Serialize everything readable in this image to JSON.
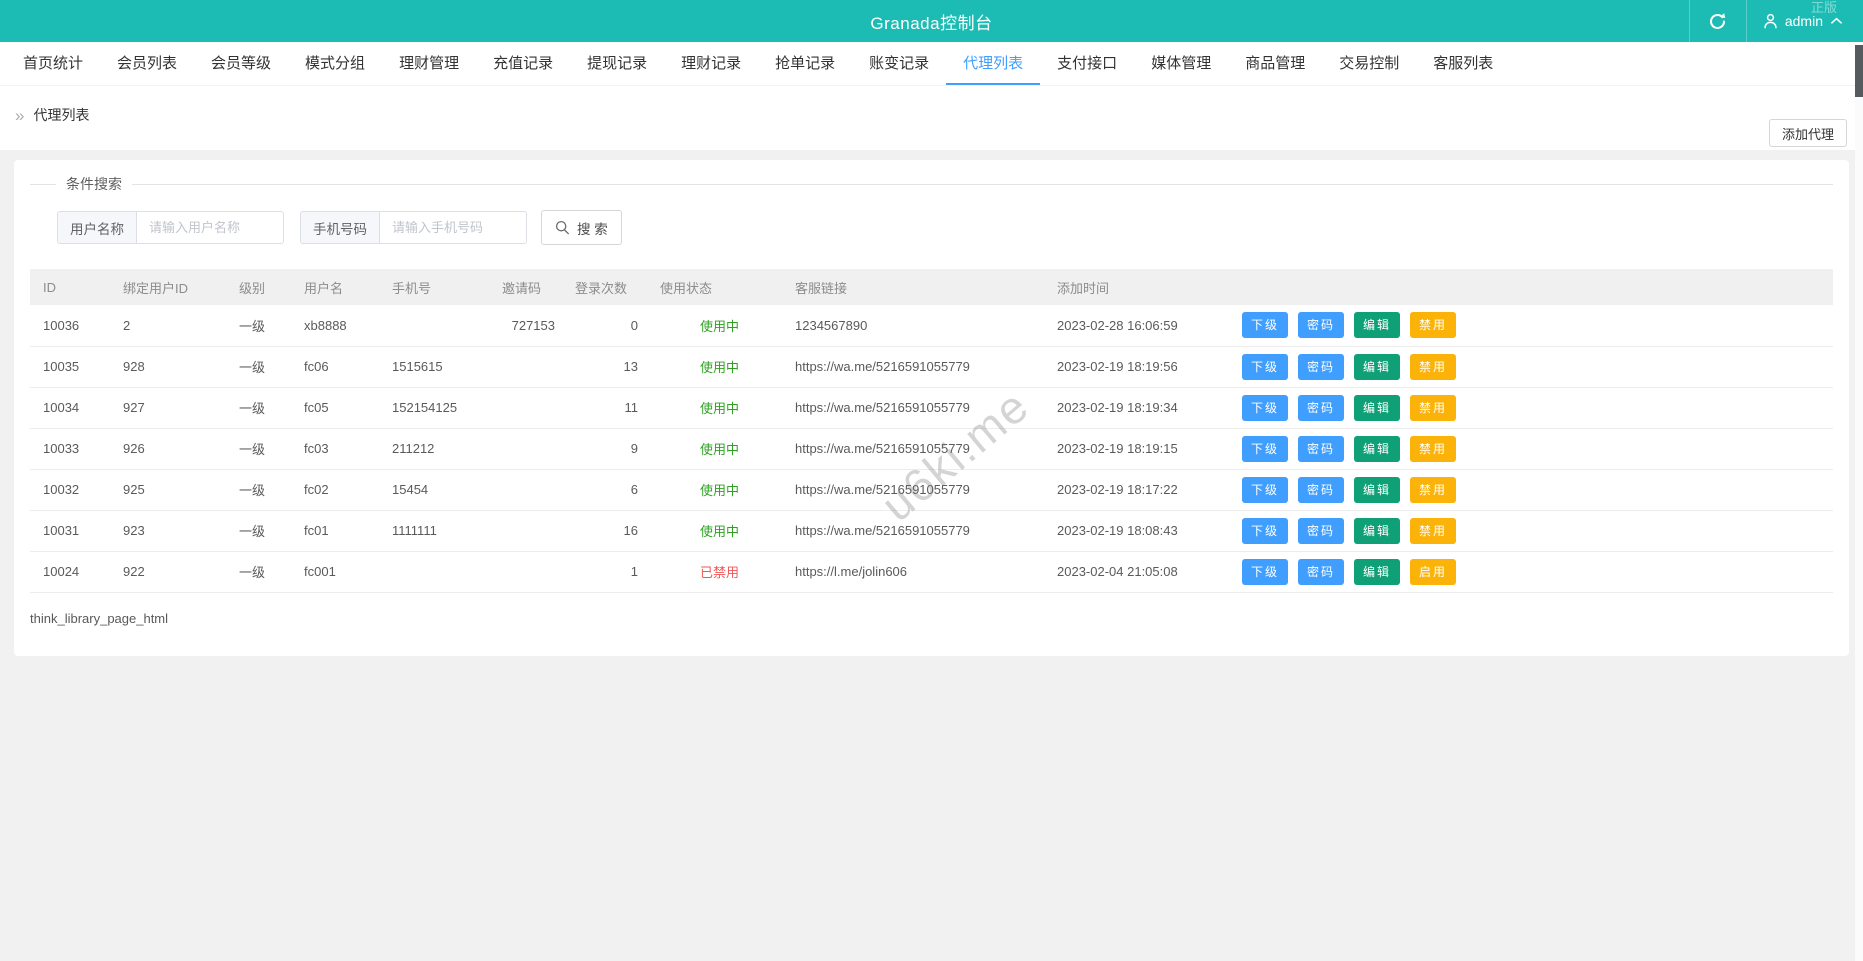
{
  "header": {
    "title": "Granada控制台",
    "user": "admin",
    "corner_watermark": "正版"
  },
  "nav": {
    "tabs": [
      {
        "label": "首页统计",
        "active": false
      },
      {
        "label": "会员列表",
        "active": false
      },
      {
        "label": "会员等级",
        "active": false
      },
      {
        "label": "模式分组",
        "active": false
      },
      {
        "label": "理财管理",
        "active": false
      },
      {
        "label": "充值记录",
        "active": false
      },
      {
        "label": "提现记录",
        "active": false
      },
      {
        "label": "理财记录",
        "active": false
      },
      {
        "label": "抢单记录",
        "active": false
      },
      {
        "label": "账变记录",
        "active": false
      },
      {
        "label": "代理列表",
        "active": true
      },
      {
        "label": "支付接口",
        "active": false
      },
      {
        "label": "媒体管理",
        "active": false
      },
      {
        "label": "商品管理",
        "active": false
      },
      {
        "label": "交易控制",
        "active": false
      },
      {
        "label": "客服列表",
        "active": false
      }
    ]
  },
  "breadcrumb": {
    "label": "代理列表"
  },
  "toolbar": {
    "add_agent_label": "添加代理"
  },
  "search": {
    "legend": "条件搜索",
    "username_label": "用户名称",
    "username_placeholder": "请输入用户名称",
    "username_value": "",
    "phone_label": "手机号码",
    "phone_placeholder": "请输入手机号码",
    "phone_value": "",
    "search_button": "搜 索"
  },
  "table": {
    "headers": [
      "ID",
      "绑定用户ID",
      "级别",
      "用户名",
      "手机号",
      "邀请码",
      "登录次数",
      "使用状态",
      "客服链接",
      "添加时间",
      ""
    ],
    "rows": [
      {
        "id": "10036",
        "bind_user_id": "2",
        "level": "一级",
        "username": "xb8888",
        "phone": "",
        "invite_code": "727153",
        "login_count": "0",
        "status": "使用中",
        "status_type": "active",
        "service_link": "1234567890",
        "added_time": "2023-02-28 16:06:59",
        "actions": [
          "下级",
          "密码",
          "编辑",
          "禁用"
        ]
      },
      {
        "id": "10035",
        "bind_user_id": "928",
        "level": "一级",
        "username": "fc06",
        "phone": "1515615",
        "invite_code": "",
        "login_count": "13",
        "status": "使用中",
        "status_type": "active",
        "service_link": "https://wa.me/5216591055779",
        "added_time": "2023-02-19 18:19:56",
        "actions": [
          "下级",
          "密码",
          "编辑",
          "禁用"
        ]
      },
      {
        "id": "10034",
        "bind_user_id": "927",
        "level": "一级",
        "username": "fc05",
        "phone": "152154125",
        "invite_code": "",
        "login_count": "11",
        "status": "使用中",
        "status_type": "active",
        "service_link": "https://wa.me/5216591055779",
        "added_time": "2023-02-19 18:19:34",
        "actions": [
          "下级",
          "密码",
          "编辑",
          "禁用"
        ]
      },
      {
        "id": "10033",
        "bind_user_id": "926",
        "level": "一级",
        "username": "fc03",
        "phone": "211212",
        "invite_code": "",
        "login_count": "9",
        "status": "使用中",
        "status_type": "active",
        "service_link": "https://wa.me/5216591055779",
        "added_time": "2023-02-19 18:19:15",
        "actions": [
          "下级",
          "密码",
          "编辑",
          "禁用"
        ]
      },
      {
        "id": "10032",
        "bind_user_id": "925",
        "level": "一级",
        "username": "fc02",
        "phone": "15454",
        "invite_code": "",
        "login_count": "6",
        "status": "使用中",
        "status_type": "active",
        "service_link": "https://wa.me/5216591055779",
        "added_time": "2023-02-19 18:17:22",
        "actions": [
          "下级",
          "密码",
          "编辑",
          "禁用"
        ]
      },
      {
        "id": "10031",
        "bind_user_id": "923",
        "level": "一级",
        "username": "fc01",
        "phone": "1111111",
        "invite_code": "",
        "login_count": "16",
        "status": "使用中",
        "status_type": "active",
        "service_link": "https://wa.me/5216591055779",
        "added_time": "2023-02-19 18:08:43",
        "actions": [
          "下级",
          "密码",
          "编辑",
          "禁用"
        ]
      },
      {
        "id": "10024",
        "bind_user_id": "922",
        "level": "一级",
        "username": "fc001",
        "phone": "",
        "invite_code": "",
        "login_count": "1",
        "status": "已禁用",
        "status_type": "disabled",
        "service_link": "https://l.me/jolin606",
        "added_time": "2023-02-04 21:05:08",
        "actions": [
          "下级",
          "密码",
          "编辑",
          "启用"
        ]
      }
    ]
  },
  "footer_note": "think_library_page_html",
  "page_watermark": "u6ki.me",
  "colors": {
    "teal": "#1cbcb4",
    "tab_active": "#409eff",
    "status_active": "#2ea121",
    "status_disabled": "#f25555",
    "btn_blue": "#409eff",
    "btn_green": "#0fa077",
    "btn_orange": "#fbb30a"
  }
}
